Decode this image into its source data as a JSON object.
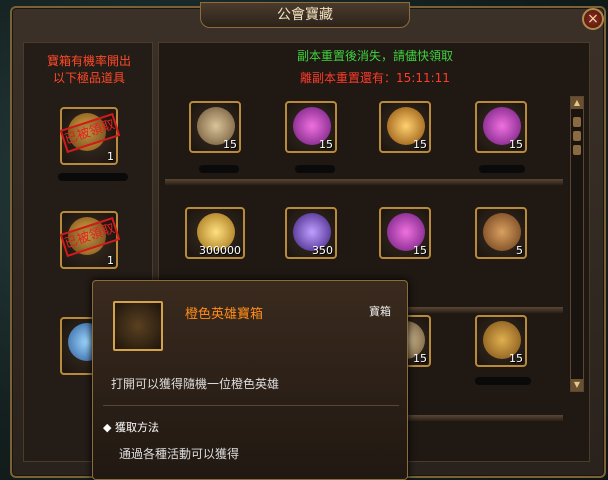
{
  "window": {
    "title": "公會寶藏",
    "close_label": "×"
  },
  "left_panel": {
    "title_line1": "寶箱有機率開出",
    "title_line2": "以下極品道具",
    "items": [
      {
        "count": "1",
        "stamp": "已被領取",
        "icon": "golden-chest-icon"
      },
      {
        "count": "1",
        "stamp": "已被領取",
        "icon": "golden-chest-icon"
      },
      {
        "icon": "blue-crystal-icon"
      }
    ]
  },
  "notices": {
    "line1": "副本重置後消失，請儘快領取",
    "line2_label": "離副本重置還有：",
    "line2_time": "15:11:11"
  },
  "grid": [
    {
      "icon": "scroll-icon",
      "count": "15"
    },
    {
      "icon": "purple-gem-icon",
      "count": "15"
    },
    {
      "icon": "golden-orb-icon",
      "count": "15"
    },
    {
      "icon": "purple-gem-icon",
      "count": "15"
    },
    {
      "icon": "gold-coin-icon",
      "count": "300000"
    },
    {
      "icon": "purple-rune-icon",
      "count": "350"
    },
    {
      "icon": "purple-gem-icon",
      "count": "15"
    },
    {
      "icon": "scroll-icon",
      "count": "5"
    },
    {
      "icon": "scroll-icon",
      "count": "15"
    },
    {
      "icon": "golden-chest-icon",
      "count": "15"
    }
  ],
  "scrollbar": {
    "up": "▲",
    "down": "▼"
  },
  "tooltip": {
    "name": "橙色英雄寶箱",
    "type": "寶箱",
    "description": "打開可以獲得隨機一位橙色英雄",
    "source_label": "獲取方法",
    "source_text": "通過各種活動可以獲得",
    "bullet": "◆",
    "icon": "golden-chest-icon"
  }
}
